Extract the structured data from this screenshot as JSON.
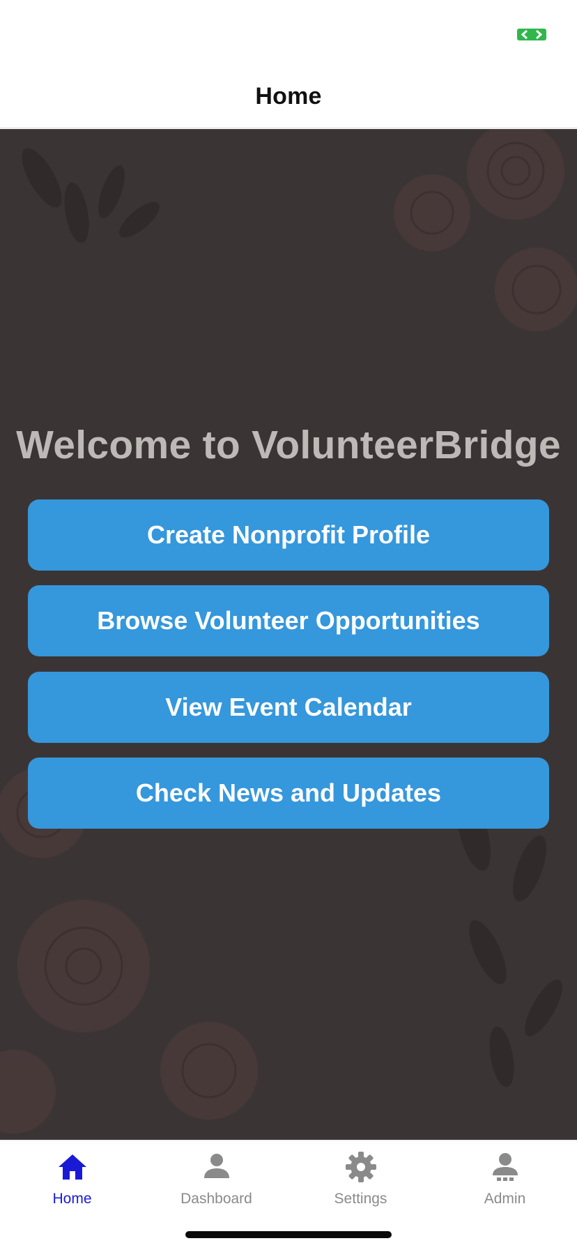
{
  "header": {
    "title": "Home"
  },
  "main": {
    "welcome": "Welcome to VolunteerBridge",
    "buttons": [
      {
        "label": "Create Nonprofit Profile"
      },
      {
        "label": "Browse Volunteer Opportunities"
      },
      {
        "label": "View Event Calendar"
      },
      {
        "label": "Check News and Updates"
      }
    ]
  },
  "tabs": [
    {
      "label": "Home",
      "icon": "home-icon",
      "active": true
    },
    {
      "label": "Dashboard",
      "icon": "person-icon",
      "active": false
    },
    {
      "label": "Settings",
      "icon": "gear-icon",
      "active": false
    },
    {
      "label": "Admin",
      "icon": "admin-icon",
      "active": false
    }
  ],
  "colors": {
    "accent": "#3597dc",
    "active_tab": "#1a1ad6",
    "inactive_tab": "#8a8a8a",
    "background": "#3a3534"
  }
}
